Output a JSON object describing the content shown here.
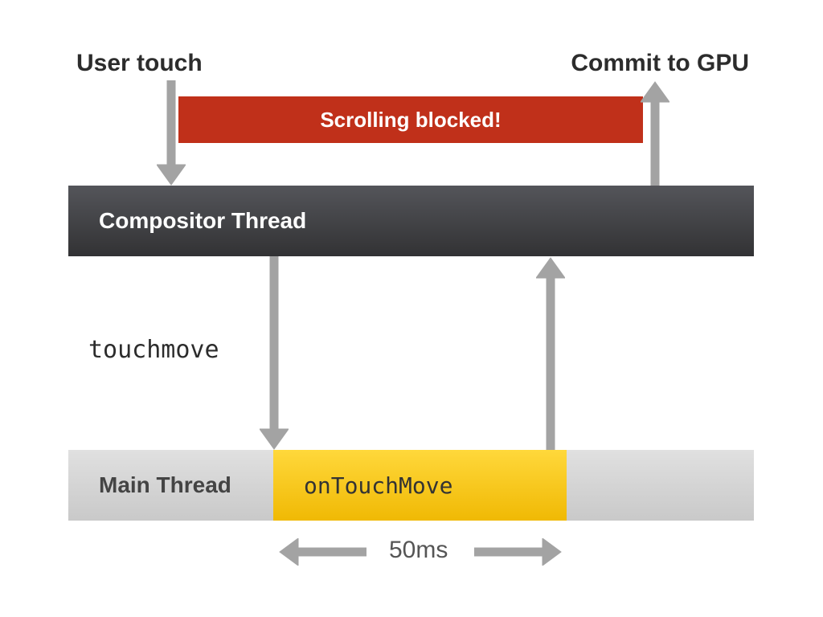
{
  "labels": {
    "user_touch": "User touch",
    "commit_gpu": "Commit to GPU",
    "scrolling_blocked": "Scrolling blocked!",
    "compositor_thread": "Compositor Thread",
    "main_thread": "Main Thread",
    "touchmove": "touchmove",
    "on_touch_move": "onTouchMove",
    "duration": "50ms"
  },
  "colors": {
    "blocked_bg": "#c0301a",
    "compositor_top": "#54555a",
    "compositor_bottom": "#323234",
    "mainthread_top": "#e0e0e0",
    "mainthread_bottom": "#c9c9c9",
    "ontouch_top": "#ffd83b",
    "ontouch_bottom": "#f0b904",
    "arrow": "#a3a3a3"
  },
  "chart_data": {
    "type": "timeline",
    "note": "Sequence diagram of blocking touch scroll handling",
    "tracks": [
      {
        "name": "Compositor Thread"
      },
      {
        "name": "Main Thread",
        "segments": [
          {
            "label": "onTouchMove",
            "duration_ms": 50
          }
        ]
      }
    ],
    "flow": [
      {
        "from": "User touch",
        "to": "Compositor Thread",
        "direction": "down"
      },
      {
        "from": "Compositor Thread",
        "to": "Main Thread",
        "label": "touchmove",
        "direction": "down"
      },
      {
        "from": "Main Thread",
        "to": "Compositor Thread",
        "direction": "up"
      },
      {
        "from": "Compositor Thread",
        "to": "Commit to GPU",
        "direction": "up"
      }
    ],
    "annotation": {
      "text": "Scrolling blocked!",
      "span_ms": 50
    }
  }
}
